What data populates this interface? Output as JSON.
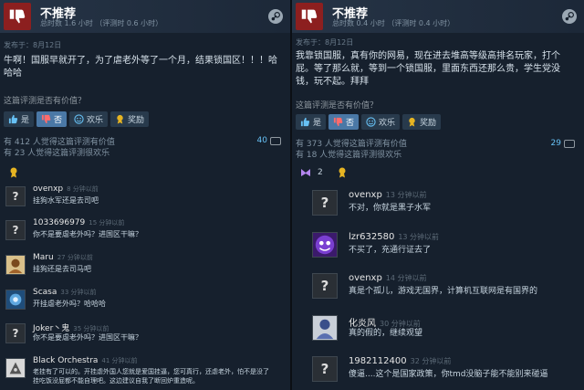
{
  "left": {
    "title": "不推荐",
    "hours": "总时数 1.6 小时 （评测时 0.6 小时）",
    "posted": "发布于：8月12日",
    "body_line1": "牛啊！国服早就开了，为了虐老外等了一个月，结果锁国区！！！哈",
    "body_line2": "哈哈",
    "helpful_q": "这篇评测是否有价值？",
    "btn_yes": "是",
    "btn_no": "否",
    "btn_funny": "欢乐",
    "btn_award": "奖励",
    "stat_helpful": "有 412 人觉得这篇评测有价值",
    "stat_funny": "有 23 人觉得这篇评测很欢乐",
    "comment_count": "40",
    "comments": [
      {
        "name": "ovenxp",
        "time": "8 分钟以前",
        "text": "挂狗水军还是去司吧"
      },
      {
        "name": "1033696979",
        "time": "15 分钟以前",
        "text": "你不是要虐老外吗？进国区干嘛？"
      },
      {
        "name": "Maru",
        "time": "27 分钟以前",
        "text": "挂狗还是去司马吧"
      },
      {
        "name": "Scasa",
        "time": "33 分钟以前",
        "text": "开挂虐老外吗？哈哈哈"
      },
      {
        "name": "Joker丶鬼",
        "time": "35 分钟以前",
        "text": "你不是要虐老外吗？进国区干嘛？"
      },
      {
        "name": "Black Orchestra",
        "time": "41 分钟以前",
        "text": "老挂有了可以的。开挂虐外国人您就是爱国挂逼，您可真行，还虐老外，怕不是没了",
        "text2": "挂吃饭没屁都不能自理吧。这边建议自我了断回炉重造呢。"
      }
    ]
  },
  "right": {
    "title": "不推荐",
    "hours": "总时数 0.4 小时 （评测时 0.4 小时）",
    "posted": "发布于：8月12日",
    "body_line1": "我靠锁国服，真有你的网易，现在进去堆高等级高排名玩家，打个",
    "body_line2": "屁。等了那么就，等到一个锁国服，里面东西还那么贵，学生党没",
    "body_line3": "钱，玩不起。拜拜",
    "helpful_q": "这篇评测是否有价值？",
    "btn_yes": "是",
    "btn_no": "否",
    "btn_funny": "欢乐",
    "btn_award": "奖励",
    "stat_helpful": "有 373 人觉得这篇评测有价值",
    "stat_funny": "有 18 人觉得这篇评测很欢乐",
    "comment_count": "29",
    "award_count": "2",
    "comments": [
      {
        "name": "ovenxp",
        "time": "13 分钟以前",
        "text": "不对，你就是黑子水军"
      },
      {
        "name": "lzr632580",
        "time": "13 分钟以前",
        "text": "不买了，充通行证去了"
      },
      {
        "name": "ovenxp",
        "time": "14 分钟以前",
        "text": "真是个孤儿，游戏无国界，计算机互联网是有国界的"
      },
      {
        "name": "化炎风",
        "time": "30 分钟以前",
        "text": "真的假的，继续观望"
      },
      {
        "name": "1982112400",
        "time": "32 分钟以前",
        "text": "傻逼....这个是国家政策，你tmd没脑子能不能别来碰逼"
      }
    ]
  },
  "colors": {
    "thumb_down": "#8c1f1f",
    "selected_vote": "#4a78a6",
    "link_blue": "#67c1f5"
  }
}
